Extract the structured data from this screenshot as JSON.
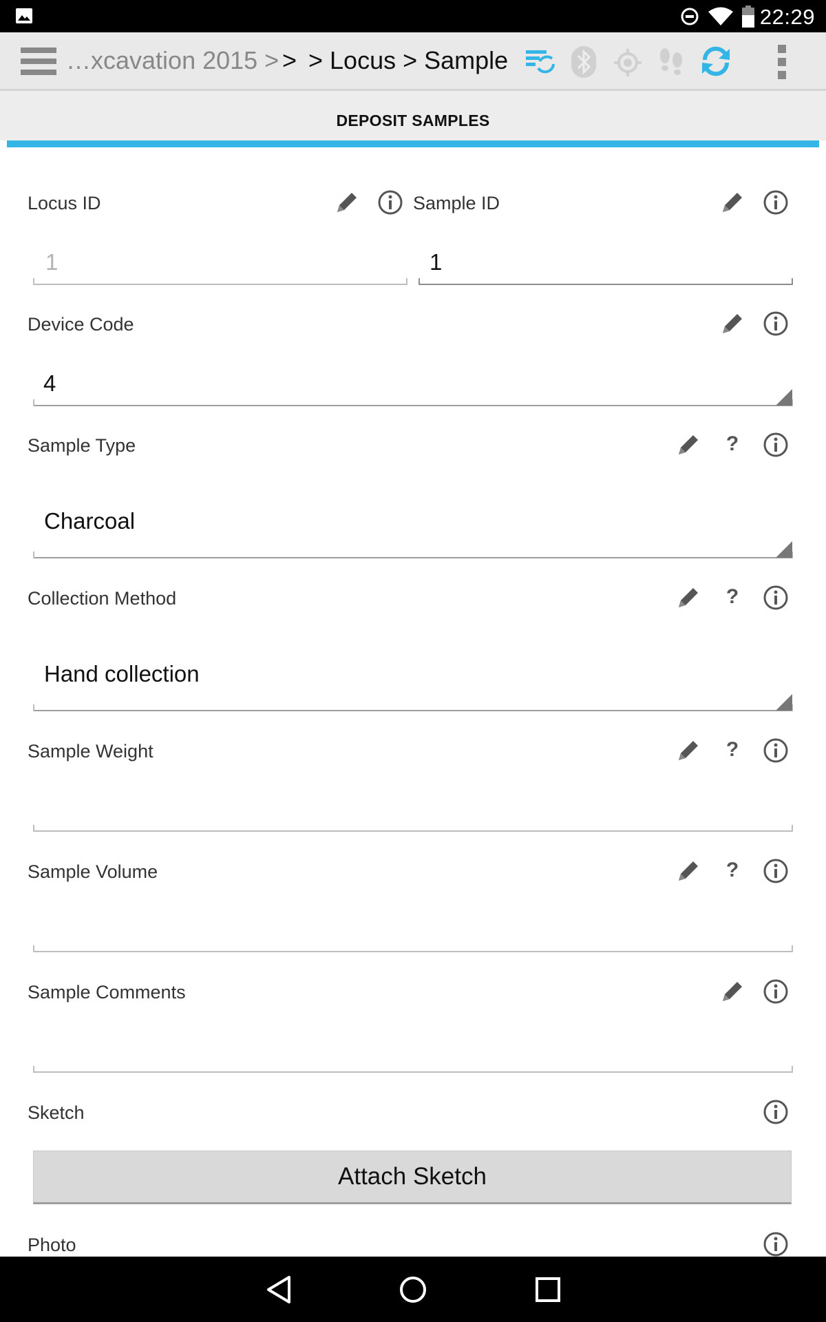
{
  "status_bar": {
    "time": "22:29"
  },
  "breadcrumb": {
    "project": "…xcavation 2015 >",
    "sep": ">",
    "current": "> Locus > Sample"
  },
  "tab": {
    "title": "DEPOSIT SAMPLES",
    "accent": "#33b5e5"
  },
  "fields": {
    "locus_id": {
      "label": "Locus ID",
      "value": "1"
    },
    "sample_id": {
      "label": "Sample ID",
      "value": "1"
    },
    "device_code": {
      "label": "Device Code",
      "value": "4"
    },
    "sample_type": {
      "label": "Sample Type",
      "value": "Charcoal"
    },
    "collection_method": {
      "label": "Collection Method",
      "value": "Hand collection"
    },
    "sample_weight": {
      "label": "Sample Weight",
      "value": ""
    },
    "sample_volume": {
      "label": "Sample Volume",
      "value": ""
    },
    "sample_comments": {
      "label": "Sample Comments",
      "value": ""
    },
    "sketch": {
      "label": "Sketch",
      "button": "Attach Sketch"
    },
    "photo": {
      "label": "Photo"
    }
  },
  "icons": {
    "toolbar": [
      "menu-icon",
      "sync-settings-icon",
      "bluetooth-icon",
      "gps-icon",
      "tracklog-icon",
      "sync-icon",
      "overflow-menu-icon"
    ],
    "field": [
      "pencil-icon",
      "help-icon",
      "info-icon"
    ]
  },
  "help_mark": "?"
}
